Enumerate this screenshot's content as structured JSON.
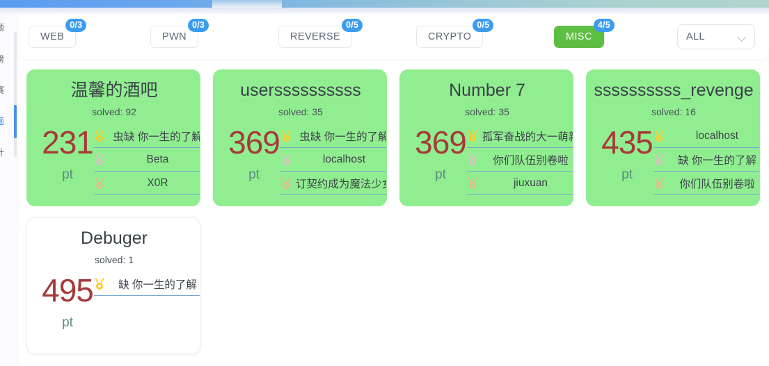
{
  "window": {
    "topbar_gradient_from": "#5b9cf0",
    "topbar_gradient_to": "#afd5cb"
  },
  "sidebar": {
    "items": [
      {
        "label": "题",
        "active": false
      },
      {
        "label": "榜",
        "active": false
      },
      {
        "label": "赛",
        "active": false
      },
      {
        "label": "题",
        "active": true
      },
      {
        "label": "计",
        "active": false
      }
    ]
  },
  "filter_bar": {
    "categories": [
      {
        "label": "WEB",
        "badge": "0/3",
        "active": false
      },
      {
        "label": "PWN",
        "badge": "0/3",
        "active": false
      },
      {
        "label": "REVERSE",
        "badge": "0/5",
        "active": false
      },
      {
        "label": "CRYPTO",
        "badge": "0/5",
        "active": false
      },
      {
        "label": "MISC",
        "badge": "4/5",
        "active": true
      }
    ],
    "dropdown": {
      "value": "ALL",
      "options": [
        "ALL"
      ]
    },
    "accent_active": "#5cbf42",
    "accent_badge": "#3c9cf0"
  },
  "cards": [
    {
      "title": "温馨的酒吧",
      "solved_label": "solved: 92",
      "score": "231",
      "unit": "pt",
      "solved": true,
      "solvers": [
        {
          "medal": "gold-medal-icon",
          "name": "虫缺 你一生的了解"
        },
        {
          "medal": "silver-medal-icon",
          "name": "Beta"
        },
        {
          "medal": "bronze-medal-icon",
          "name": "X0R"
        }
      ]
    },
    {
      "title": "userssssssssss",
      "solved_label": "solved: 35",
      "score": "369",
      "unit": "pt",
      "solved": true,
      "solvers": [
        {
          "medal": "gold-medal-icon",
          "name": "虫缺 你一生的了解"
        },
        {
          "medal": "silver-medal-icon",
          "name": "localhost"
        },
        {
          "medal": "bronze-medal-icon",
          "name": "订契约成为魔法少女"
        }
      ]
    },
    {
      "title": "Number 7",
      "solved_label": "solved: 35",
      "score": "369",
      "unit": "pt",
      "solved": true,
      "solvers": [
        {
          "medal": "gold-medal-icon",
          "name": "孤军奋战的大一萌新"
        },
        {
          "medal": "silver-medal-icon",
          "name": "你们队伍别卷啦"
        },
        {
          "medal": "bronze-medal-icon",
          "name": "jiuxuan"
        }
      ]
    },
    {
      "title": "ssssssssss_revenge",
      "solved_label": "solved: 16",
      "score": "435",
      "unit": "pt",
      "solved": true,
      "solvers": [
        {
          "medal": "gold-medal-icon",
          "name": "localhost"
        },
        {
          "medal": "silver-medal-icon",
          "name": "缺 你一生的了解"
        },
        {
          "medal": "bronze-medal-icon",
          "name": "你们队伍别卷啦"
        }
      ]
    },
    {
      "title": "Debuger",
      "solved_label": "solved: 1",
      "score": "495",
      "unit": "pt",
      "solved": false,
      "solvers": [
        {
          "medal": "gold-medal-icon",
          "name": "缺 你一生的了解"
        }
      ]
    }
  ],
  "colors": {
    "card_solved_bg": "#90ee90",
    "score_text": "#a63a3a",
    "unit_text": "#5d8a7e",
    "underline": "#7aa7d8"
  }
}
